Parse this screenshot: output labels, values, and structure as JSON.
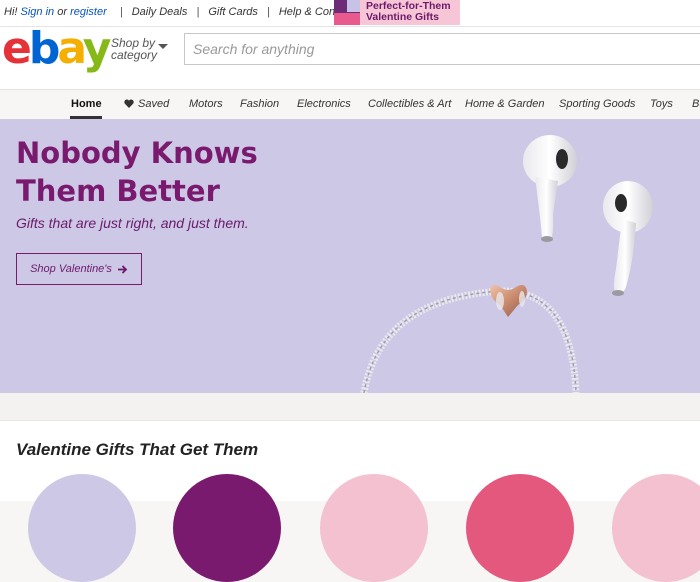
{
  "topbar": {
    "greeting": "Hi!",
    "sign_in": "Sign in",
    "or": "or",
    "register": "register",
    "links": [
      "Daily Deals",
      "Gift Cards",
      "Help & Contact"
    ],
    "promo_line1": "Perfect-for-Them",
    "promo_line2": "Valentine Gifts"
  },
  "header": {
    "logo": {
      "e": "e",
      "b": "b",
      "a": "a",
      "y": "y"
    },
    "shop_by_line1": "Shop by",
    "shop_by_line2": "category",
    "search_placeholder": "Search for anything"
  },
  "nav": {
    "items": [
      "Home",
      "Saved",
      "Motors",
      "Fashion",
      "Electronics",
      "Collectibles & Art",
      "Home & Garden",
      "Sporting Goods",
      "Toys",
      "Bu"
    ]
  },
  "hero": {
    "title_line1": "Nobody Knows",
    "title_line2": "Them Better",
    "subtitle": "Gifts that are just right, and just them.",
    "cta": "Shop Valentine's",
    "cta_icon": "arrow-right-icon"
  },
  "section": {
    "title": "Valentine Gifts That Get Them"
  },
  "colors": {
    "brand_purple": "#7a1a6e",
    "hero_bg": "#cdc8e6",
    "link_blue": "#0654ba"
  }
}
